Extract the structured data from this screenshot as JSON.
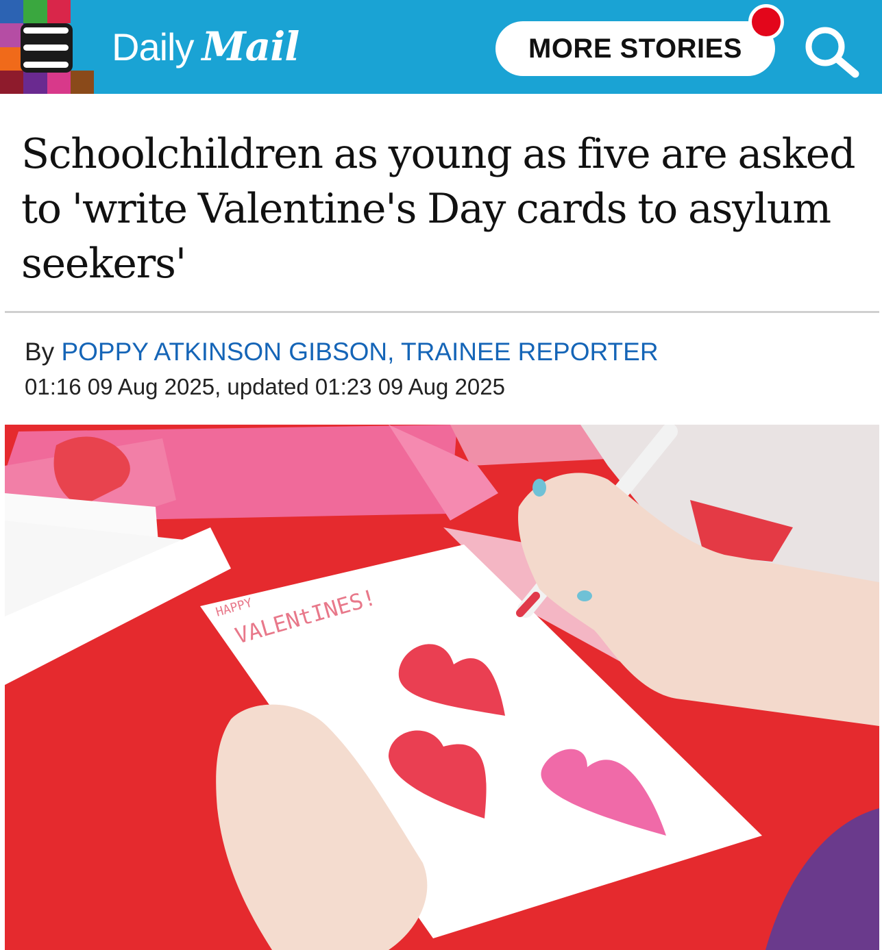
{
  "header": {
    "logo_daily": "Daily",
    "logo_mail": "Mail",
    "more_stories_label": "MORE STORIES",
    "menu_icon": "hamburger-menu-icon",
    "search_icon": "search-icon",
    "background_color": "#1aa3d4",
    "notification_color": "#e3061b"
  },
  "article": {
    "headline": "Schoolchildren as young as five are asked to 'write Valentine's Day cards to asylum seekers'",
    "byline_prefix": "By ",
    "author": "POPPY ATKINSON GIBSON, TRAINEE REPORTER",
    "dateline": "01:16 09 Aug 2025, updated 01:23 09 Aug 2025",
    "author_color": "#1565b7"
  },
  "photo": {
    "card_text_line1": "HAPPY",
    "card_text_line2": "VALENtINES!"
  }
}
